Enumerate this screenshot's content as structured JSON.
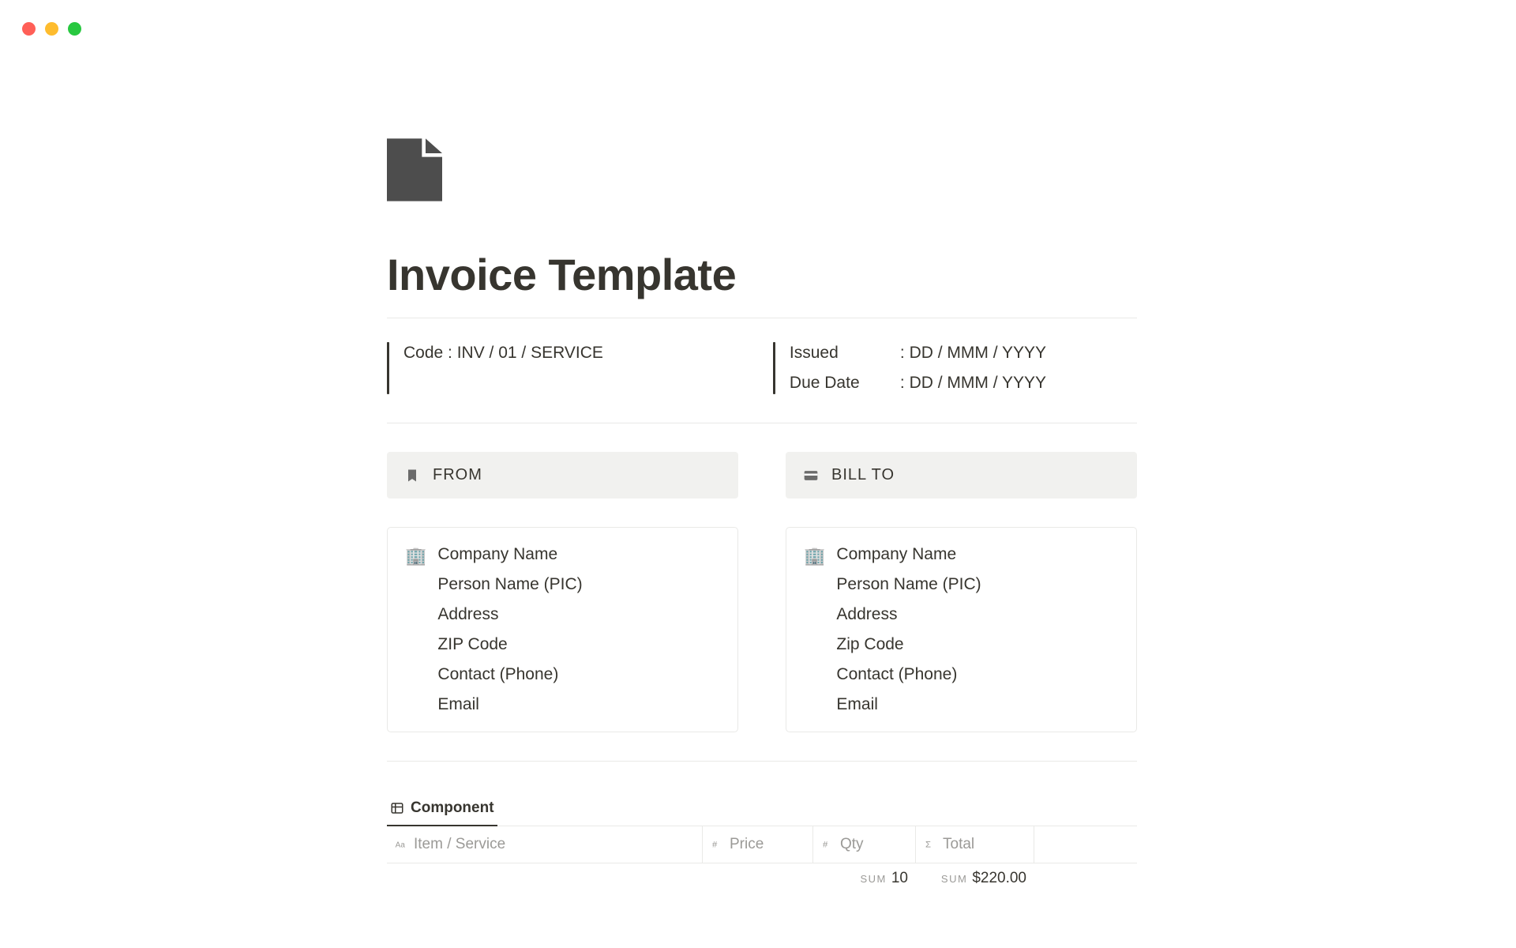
{
  "title": "Invoice Template",
  "meta": {
    "code_label": "Code : INV / 01 / SERVICE",
    "issued_label": "Issued",
    "issued_value": ": DD / MMM / YYYY",
    "due_label": "Due Date",
    "due_value": ": DD / MMM / YYYY"
  },
  "from": {
    "header": "FROM",
    "icon": "🏢",
    "lines": {
      "company": "Company Name",
      "person": "Person Name (PIC)",
      "address": "Address",
      "zip": "ZIP Code",
      "contact": "Contact (Phone)",
      "email": "Email"
    }
  },
  "bill_to": {
    "header": "BILL TO",
    "icon": "🏢",
    "lines": {
      "company": "Company Name",
      "person": "Person Name (PIC)",
      "address": "Address",
      "zip": "Zip Code",
      "contact": "Contact (Phone)",
      "email": "Email"
    }
  },
  "db": {
    "tab_label": "Component",
    "columns": {
      "item": "Item / Service",
      "price": "Price",
      "qty": "Qty",
      "total": "Total"
    },
    "sum": {
      "label": "SUM",
      "qty": "10",
      "total": "$220.00"
    }
  }
}
